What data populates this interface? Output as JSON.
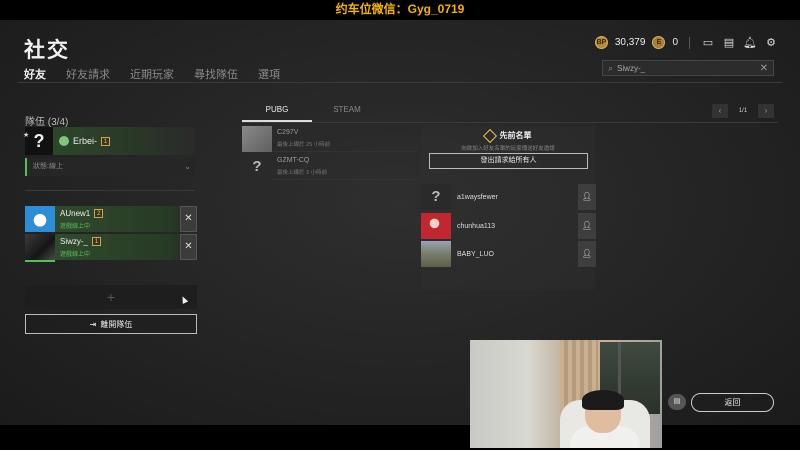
{
  "stream_banner": "约车位微信：Gyg_0719",
  "page_title": "社交",
  "tabs": [
    {
      "label": "好友",
      "active": true
    },
    {
      "label": "好友請求",
      "active": false
    },
    {
      "label": "近期玩家",
      "active": false
    },
    {
      "label": "尋找隊伍",
      "active": false
    },
    {
      "label": "選項",
      "active": false
    }
  ],
  "topbar": {
    "bp_icon": "BP",
    "bp_amount": "30,379",
    "e_icon": "E",
    "e_amount": "0"
  },
  "search": {
    "value": "Siwzy-_"
  },
  "party": {
    "title": "隊伍 (3/4)",
    "leader": {
      "name": "Erbei-",
      "level": "1"
    },
    "status": "狀態:線上",
    "members": [
      {
        "name": "AUnew1",
        "level": "2",
        "status": "遊戲線上中"
      },
      {
        "name": "Siwzy-_",
        "level": "1",
        "status": "遊戲線上中"
      }
    ],
    "empty_slot": "+",
    "leave_button": "離開隊伍"
  },
  "platform_tabs": [
    {
      "label": "PUBG",
      "active": true
    },
    {
      "label": "STEAM",
      "active": false
    }
  ],
  "pager": {
    "prev": "‹",
    "page": "1/1",
    "next": "›"
  },
  "friends": [
    {
      "name": "C297V",
      "status": "最後上線於 25 小時前"
    },
    {
      "name": "GZMT-CQ",
      "status": "最後上線於 3 小時前"
    }
  ],
  "invite_panel": {
    "title": "先前名單",
    "desc": "向欲加入好友名單的玩家傳送好友邀請",
    "button": "發出請求給所有人",
    "players": [
      {
        "name": "a1waysfewer"
      },
      {
        "name": "chunhua113"
      },
      {
        "name": "BABY_LUO"
      }
    ]
  },
  "back_button": "返回",
  "icons": {
    "leader_avatar": "?",
    "gz_avatar": "?"
  }
}
